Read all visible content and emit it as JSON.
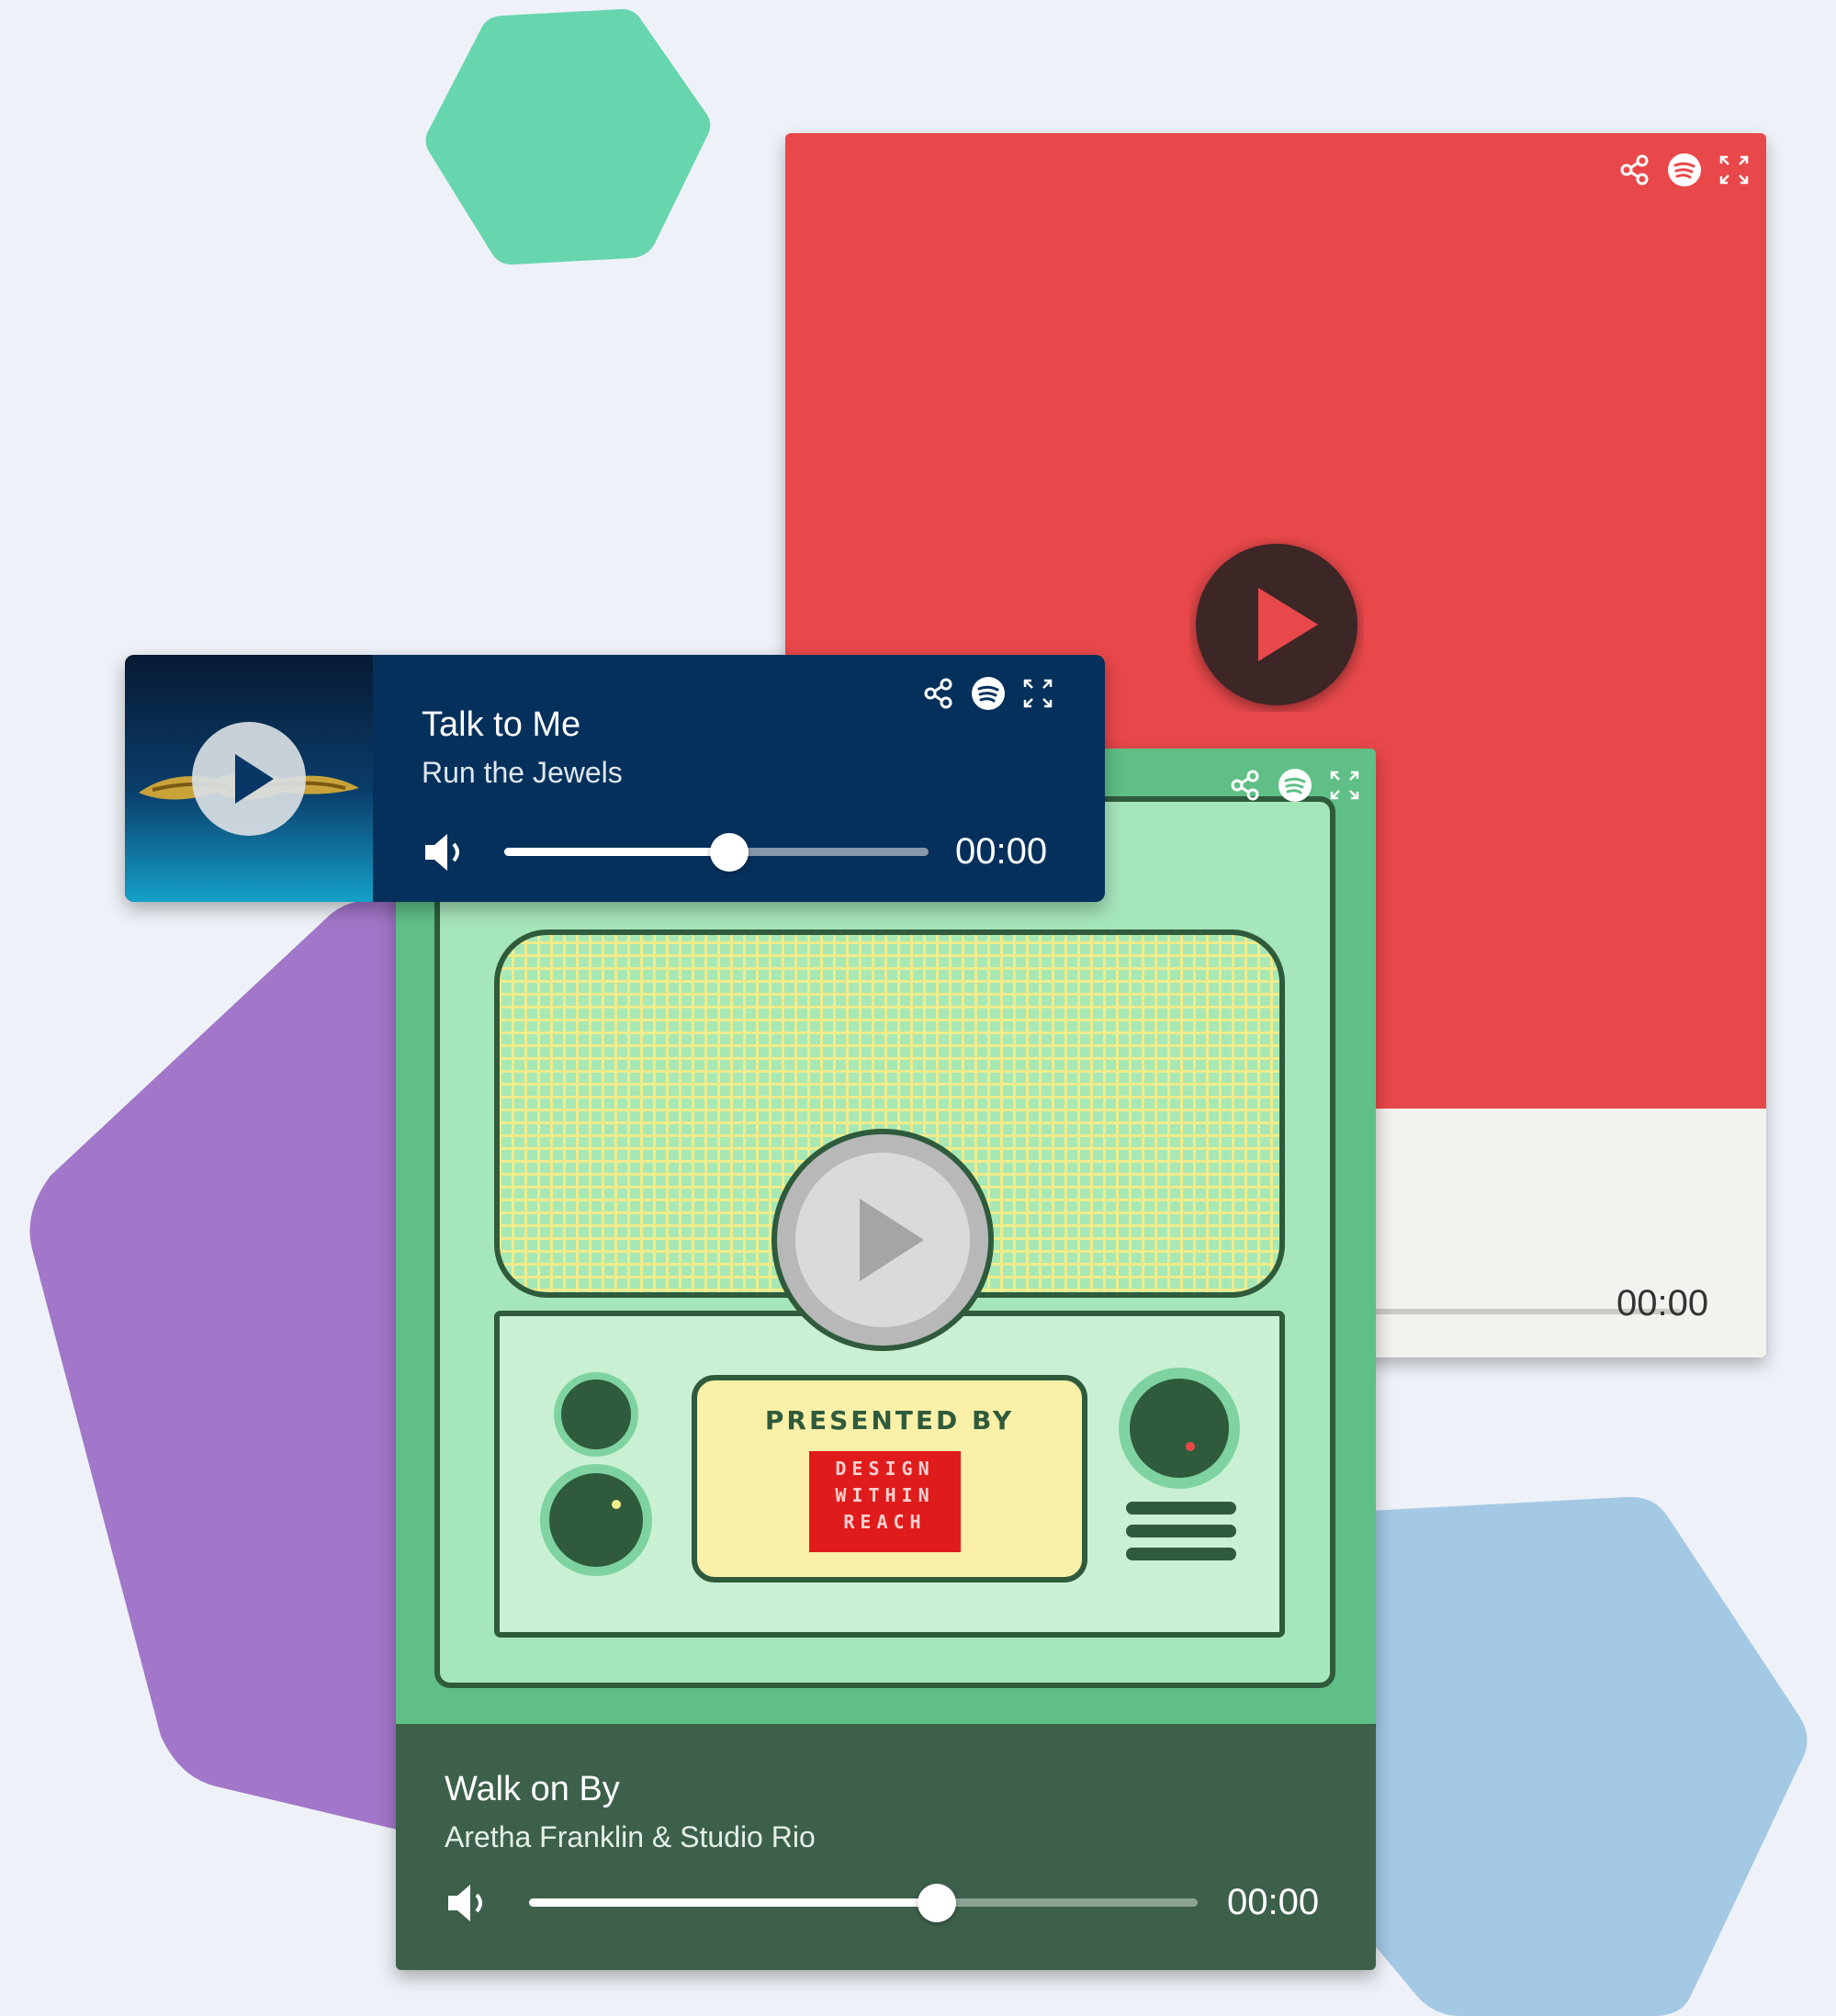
{
  "colors": {
    "background": "#eef2f8",
    "hex_green": "#67d5ad",
    "hex_purple": "#a276c8",
    "hex_blue": "#a4c9e5",
    "red_art": "#e8484a",
    "dark_player": "#05305c",
    "green_player_bar": "#3d604b"
  },
  "icons": [
    "share-icon",
    "spotify-icon",
    "expand-icon",
    "play-icon",
    "volume-icon"
  ],
  "players": {
    "red": {
      "time": "00:00"
    },
    "dark": {
      "title": "Talk to Me",
      "artist": "Run the Jewels",
      "time": "00:00",
      "volume_level": 0.53
    },
    "green": {
      "title": "Walk on By",
      "artist": "Aretha Franklin & Studio Rio",
      "time": "00:00",
      "volume_level": 0.61,
      "art_text": {
        "presented_by": "PRESENTED BY",
        "logo_line1": "DESIGN",
        "logo_line2": "WITHIN",
        "logo_line3": "REACH"
      }
    }
  }
}
